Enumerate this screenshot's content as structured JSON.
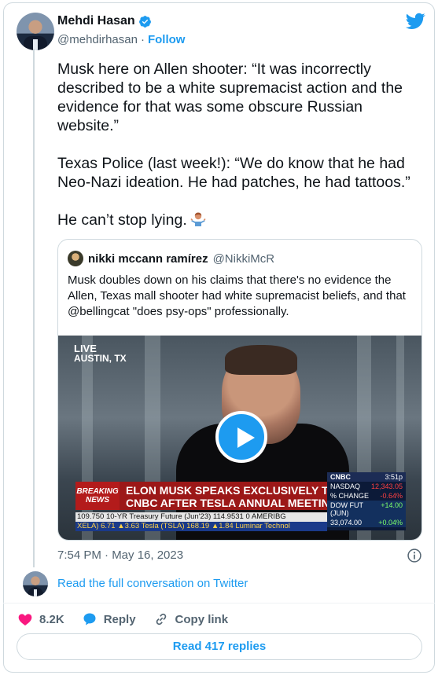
{
  "author": {
    "name": "Mehdi Hasan",
    "handle": "@mehdirhasan",
    "separator": "·",
    "follow_label": "Follow"
  },
  "tweet": {
    "paragraphs": [
      "Musk here on Allen shooter: “It was incorrectly described to be a white supremacist action and the evidence for that was some obscure Russian website.”",
      "Texas Police (last week!): “We do know that he had Neo-Nazi ideation. He had patches, he had tattoos.”",
      "He can’t stop lying."
    ],
    "timestamp": "7:54 PM · May 16, 2023"
  },
  "quoted": {
    "name": "nikki mccann ramírez",
    "handle": "@NikkiMcR",
    "text": "Musk doubles down on his claims that there's no evidence the Allen, Texas mall shooter had white supremacist beliefs, and that @bellingcat \"does psy-ops\" professionally.",
    "video": {
      "live_label": "LIVE",
      "location": "AUSTIN, TX",
      "breaking_label_1": "BREAKING",
      "breaking_label_2": "NEWS",
      "headline_1": "ELON MUSK SPEAKS EXCLUSIVELY TO",
      "headline_2": "CNBC AFTER TESLA ANNUAL MEETING",
      "cnbc_logo": "CNBC",
      "cnbc_time": "3:51p",
      "nasdaq_label": "NASDAQ",
      "nasdaq_value": "12,343.05",
      "change_label": "% CHANGE",
      "change_value": "-0.64%",
      "dow_label": "DOW FUT (JUN)",
      "dow_change": "+14.00",
      "dow_value": "33,074.00",
      "dow_pct": "+0.04%",
      "ticker_line_1": "109.750   10-YR Treasury Future (Jun'23) 114.9531   0 AMERIBG",
      "ticker_line_2": "XELA) 6.71 ▲3.63    Tesla (TSLA) 168.19 ▲1.84    Luminar Technol"
    }
  },
  "footer": {
    "read_full": "Read the full conversation on Twitter",
    "likes_count": "8.2K",
    "reply_label": "Reply",
    "copy_link_label": "Copy link",
    "read_replies": "Read 417 replies"
  },
  "colors": {
    "accent": "#1d9bf0",
    "like": "#f91880",
    "text": "#0f1419",
    "muted": "#536471"
  },
  "icons": [
    "verified-badge-icon",
    "twitter-bird-icon",
    "play-icon",
    "info-icon",
    "heart-icon",
    "reply-bubble-icon",
    "link-icon",
    "shrug-emoji-icon"
  ]
}
